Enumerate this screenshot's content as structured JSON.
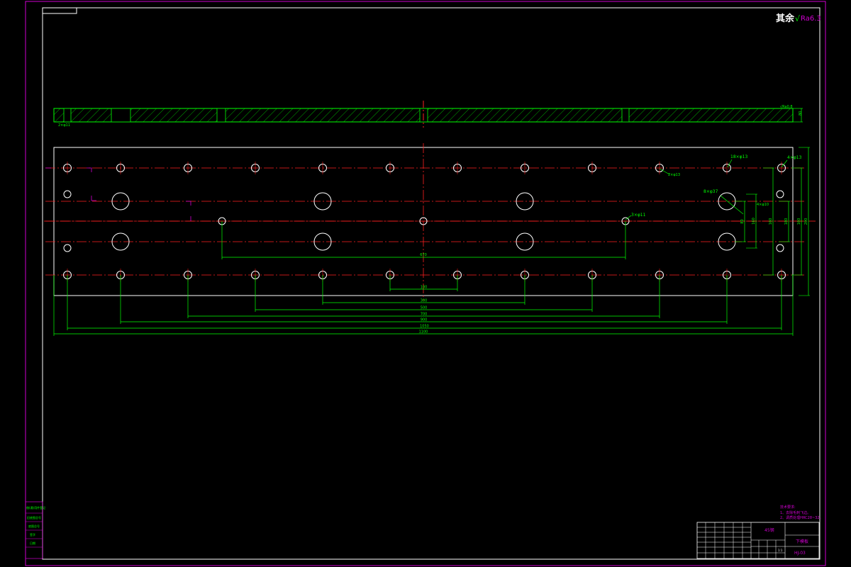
{
  "surface_finish": {
    "prefix": "其余",
    "symbol": "√",
    "value": "Ra6.3"
  },
  "section_view": {
    "left_callout": "2×φ11",
    "right_callout": "√Ra0.8",
    "thickness": "80"
  },
  "callouts": {
    "top_row_holes": "18×φ13",
    "corner_holes": "4×φ13",
    "bolt_holes": "8×φ37",
    "center_holes": "3×φ11",
    "side_holes": "4×φ10",
    "middle_left": "2×φ13"
  },
  "dims_horizontal": [
    "100",
    "300",
    "500",
    "700",
    "900",
    "1050",
    "1100"
  ],
  "dim_center": "670",
  "dims_vertical": [
    "80",
    "160",
    "160",
    "180",
    "160",
    "200"
  ],
  "tech_notes": {
    "title": "技术要求:",
    "lines": [
      "1、去除毛刺飞边。",
      "2、调质处理HRC28~32。"
    ]
  },
  "title_block": {
    "material": "45钢",
    "part_name": "下模板",
    "drawing_no": "HJ-03",
    "scale": "1:1"
  },
  "side_labels": [
    "借(通)用件登记",
    "旧底图总号",
    "底图总号",
    "签字",
    "日期"
  ]
}
